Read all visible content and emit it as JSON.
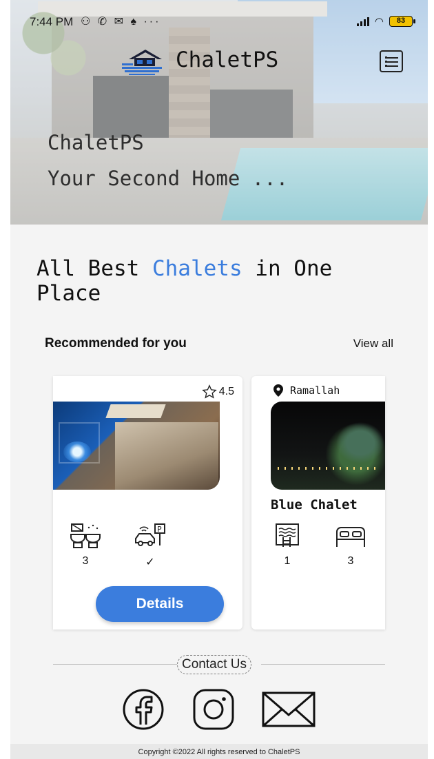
{
  "status_bar": {
    "time": "7:44 PM",
    "notification_icons": "⚇ ✆ ✉ ♠ ···",
    "battery": "83"
  },
  "header": {
    "app_name": "ChaletPS",
    "logo_icon": "house-logo-icon",
    "menu_icon": "list-menu-icon"
  },
  "hero": {
    "title": "ChaletPS",
    "subtitle": "Your Second Home ..."
  },
  "headline": {
    "part1": "All Best ",
    "accent": "Chalets",
    "part2": " in One Place",
    "accent_color": "#3b7ddd"
  },
  "recommended": {
    "title": "Recommended for you",
    "view_all": "View all"
  },
  "cards": [
    {
      "rating": "4.5",
      "features": [
        {
          "icon": "bathroom-icon",
          "value": "3"
        },
        {
          "icon": "parking-icon",
          "value": "✓"
        }
      ],
      "button_label": "Details"
    },
    {
      "location": "Ramallah",
      "name": "Blue Chalet",
      "features": [
        {
          "icon": "pool-icon",
          "value": "1"
        },
        {
          "icon": "bed-icon",
          "value": "3"
        }
      ]
    }
  ],
  "footer": {
    "contact_label": "Contact Us",
    "social": [
      "facebook-icon",
      "instagram-icon",
      "email-icon"
    ],
    "copyright": "Copyright ©2022 All rights reserved to ChaletPS"
  }
}
